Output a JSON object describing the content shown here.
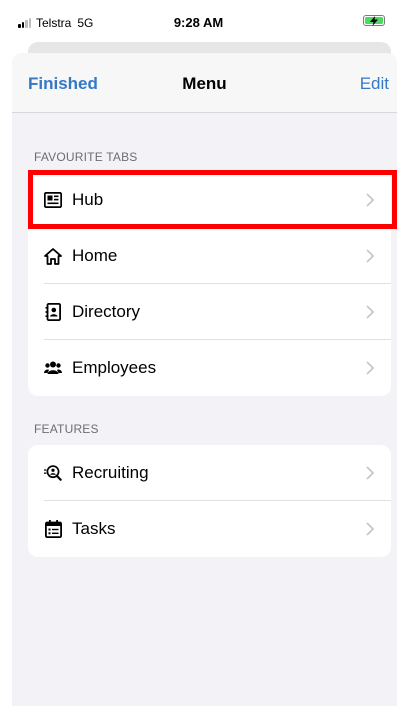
{
  "status_bar": {
    "carrier": "Telstra",
    "network": "5G",
    "time": "9:28 AM"
  },
  "nav": {
    "left_label": "Finished",
    "title": "Menu",
    "right_label": "Edit"
  },
  "sections": {
    "favourites": {
      "header": "FAVOURITE TABS",
      "items": [
        {
          "label": "Hub",
          "icon": "newspaper-icon"
        },
        {
          "label": "Home",
          "icon": "home-icon"
        },
        {
          "label": "Directory",
          "icon": "contact-book-icon"
        },
        {
          "label": "Employees",
          "icon": "people-icon"
        }
      ]
    },
    "features": {
      "header": "FEATURES",
      "items": [
        {
          "label": "Recruiting",
          "icon": "person-search-icon"
        },
        {
          "label": "Tasks",
          "icon": "calendar-checklist-icon"
        }
      ]
    }
  },
  "colors": {
    "accent": "#3478c6",
    "highlight": "#ff0000",
    "group_background": "#f2f2f7"
  }
}
